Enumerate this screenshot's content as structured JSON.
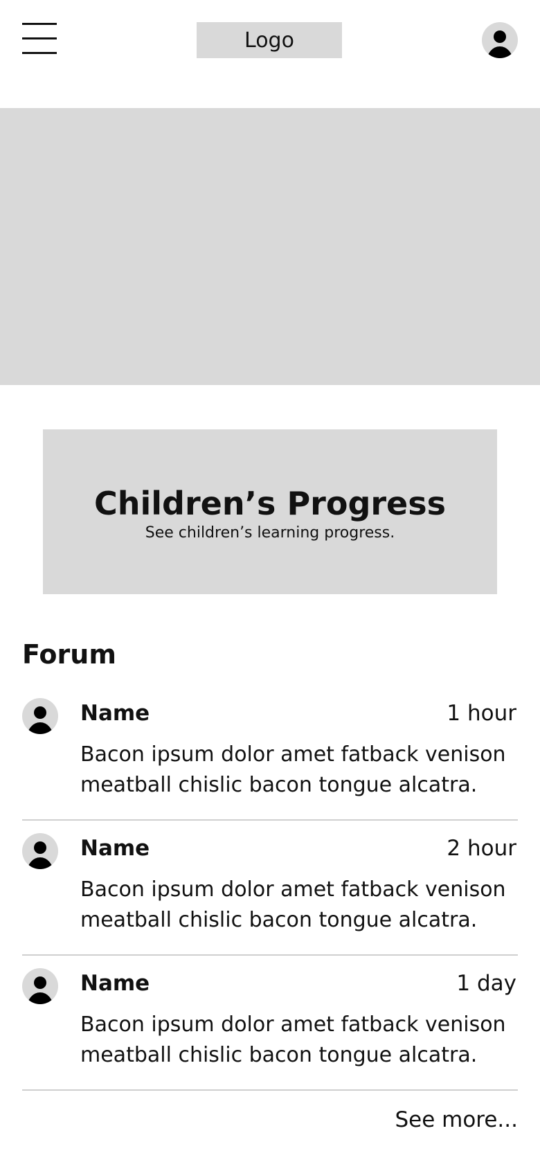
{
  "header": {
    "menu_icon": "hamburger-menu-icon",
    "logo": "Logo",
    "avatar_icon": "user-avatar-icon"
  },
  "hero": {
    "image_placeholder": "hero-image-placeholder"
  },
  "progress_card": {
    "title": "Children’s Progress",
    "subtitle": "See children’s learning progress."
  },
  "forum": {
    "heading": "Forum",
    "posts": [
      {
        "name": "Name",
        "time": "1 hour",
        "text": "Bacon ipsum dolor amet fatback venison meatball chislic bacon tongue alcatra."
      },
      {
        "name": "Name",
        "time": "2 hour",
        "text": "Bacon ipsum dolor amet fatback venison meatball chislic bacon tongue alcatra."
      },
      {
        "name": "Name",
        "time": "1 day",
        "text": "Bacon ipsum dolor amet fatback venison meatball chislic bacon tongue alcatra."
      }
    ],
    "see_more": "See more..."
  },
  "colors": {
    "placeholder_gray": "#d9d9d9",
    "divider": "#cfcfcf",
    "text": "#111111"
  }
}
